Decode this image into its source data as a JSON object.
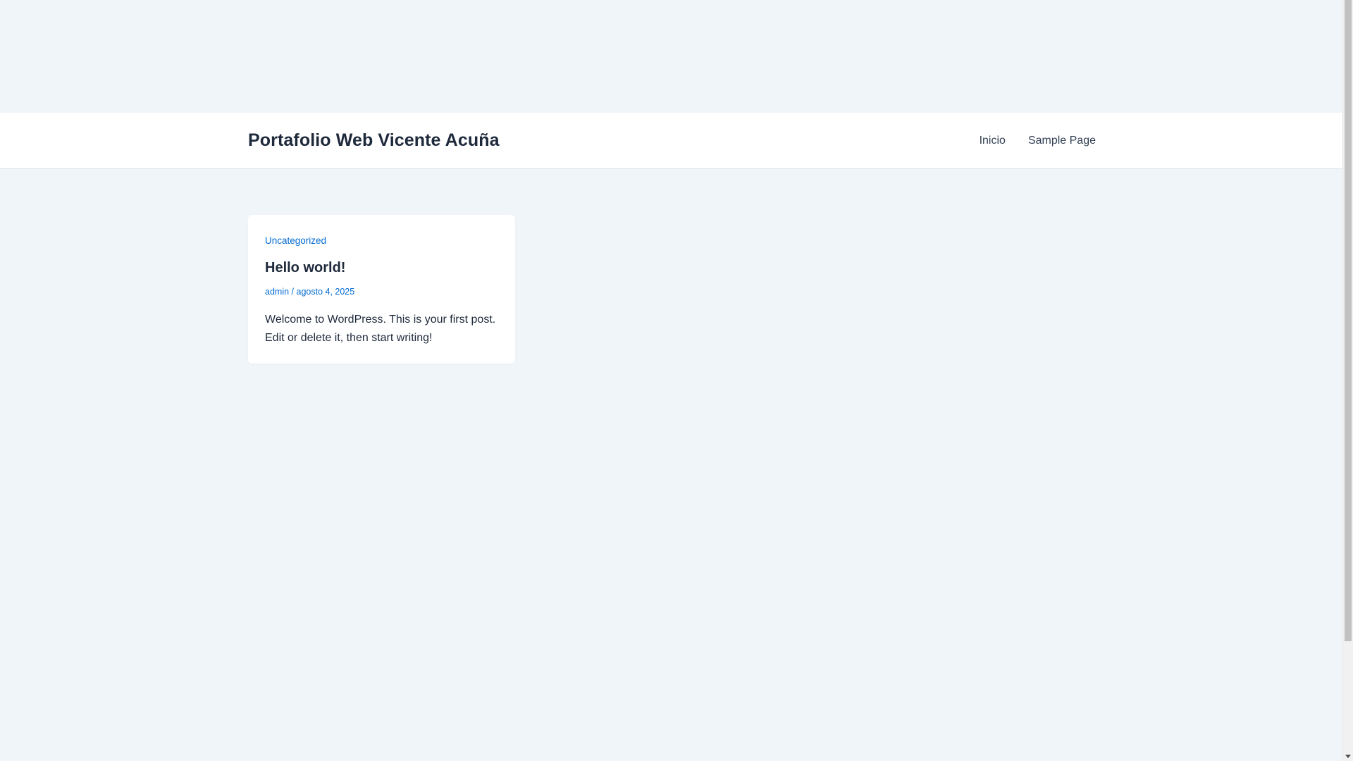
{
  "site": {
    "title": "Portafolio Web Vicente Acuña"
  },
  "nav": {
    "items": [
      {
        "label": "Inicio"
      },
      {
        "label": "Sample Page"
      }
    ]
  },
  "post": {
    "category": "Uncategorized",
    "title": "Hello world!",
    "author": "admin",
    "separator": "/",
    "date": "agosto 4, 2025",
    "excerpt": "Welcome to WordPress. This is your first post. Edit or delete it, then start writing!"
  },
  "colors": {
    "background": "#f0f5fa",
    "header": "#ffffff",
    "link": "#046bd2",
    "heading": "#1e293b"
  }
}
